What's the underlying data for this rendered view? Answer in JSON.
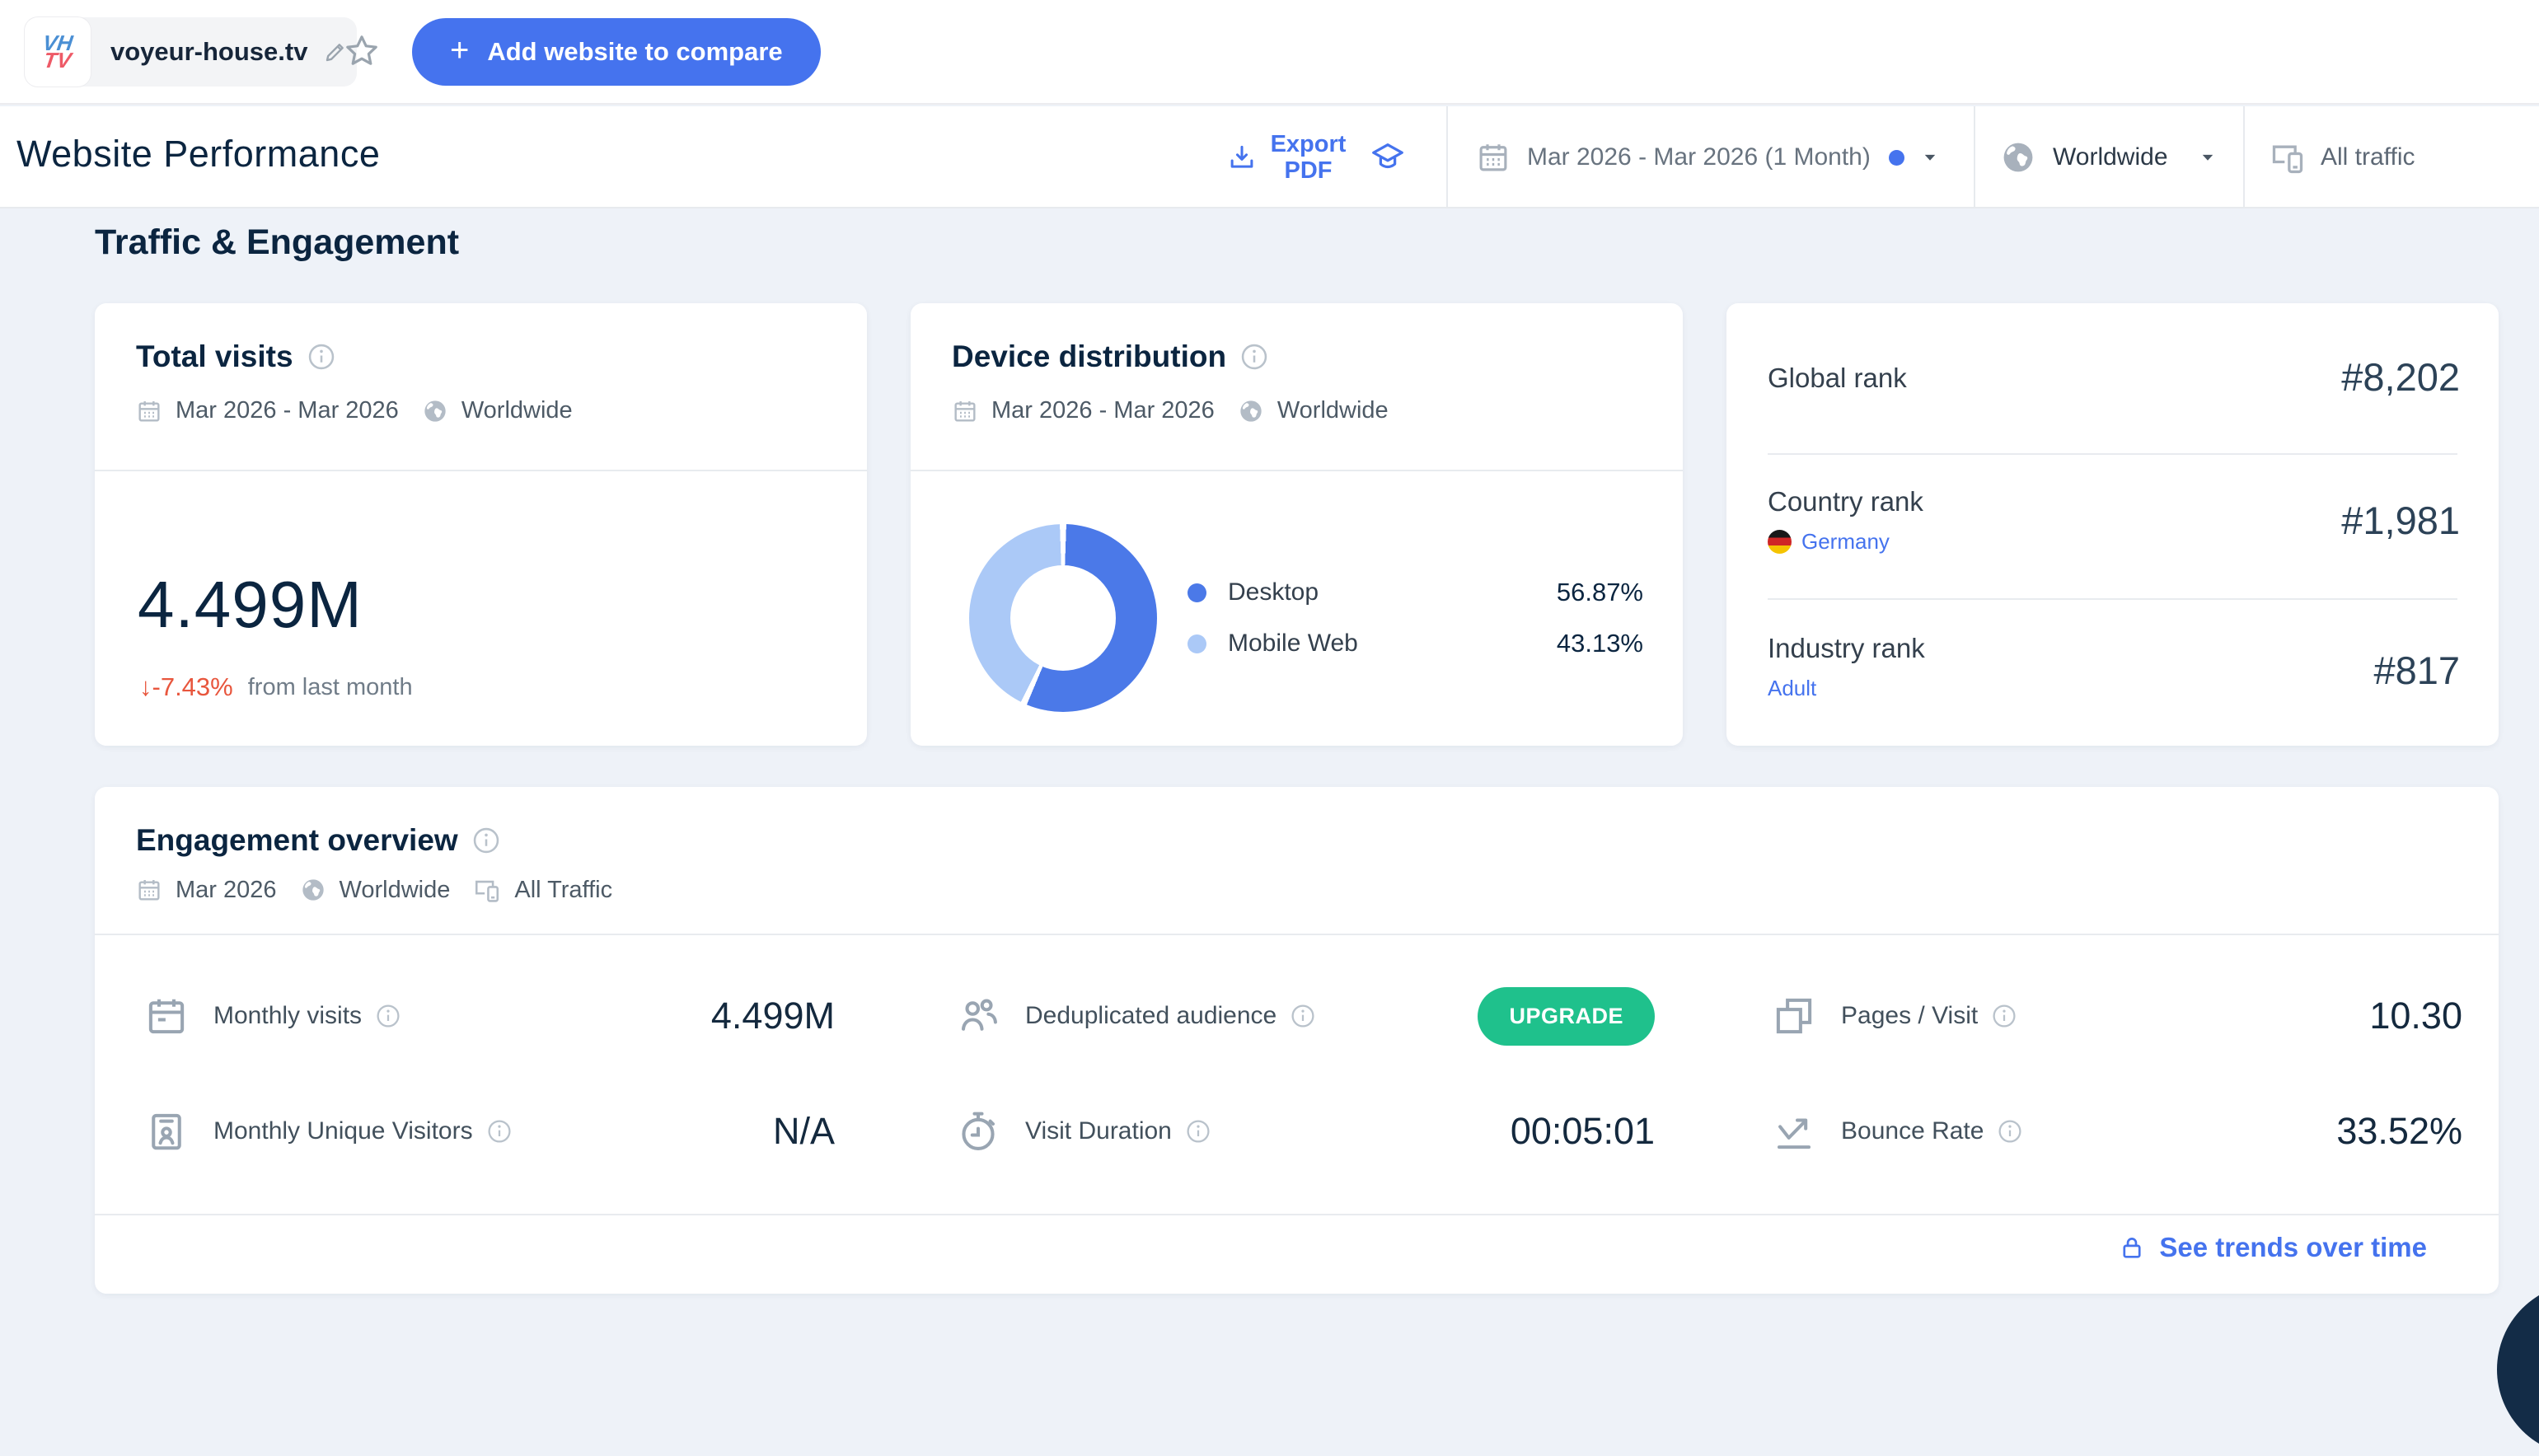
{
  "top_bar": {
    "favicon": {
      "line1": "VH",
      "line2": "TV"
    },
    "domain": "voyeur-house.tv",
    "compare": {
      "plus": "+",
      "label": "Add website to compare"
    }
  },
  "header": {
    "title": "Website Performance",
    "export_pdf": {
      "line1": "Export",
      "line2": "PDF"
    },
    "date_range": "Mar 2026 - Mar 2026 (1 Month)",
    "geo": "Worldwide",
    "traffic": "All traffic"
  },
  "section_title": "Traffic & Engagement",
  "total_visits": {
    "title": "Total visits",
    "date": "Mar 2026 - Mar 2026",
    "geo": "Worldwide",
    "value": "4.499M",
    "change": "↓-7.43%",
    "change_note": "from last month"
  },
  "device_distribution": {
    "title": "Device distribution",
    "date": "Mar 2026 - Mar 2026",
    "geo": "Worldwide"
  },
  "ranks": {
    "global_label": "Global rank",
    "global_value": "#8,202",
    "country_label": "Country rank",
    "country_link": "Germany",
    "country_value": "#1,981",
    "industry_label": "Industry rank",
    "industry_link": "Adult",
    "industry_value": "#817"
  },
  "engagement": {
    "title": "Engagement overview",
    "date": "Mar 2026",
    "geo": "Worldwide",
    "traffic": "All Traffic",
    "metrics": [
      {
        "label": "Monthly visits",
        "value": "4.499M"
      },
      {
        "label": "Deduplicated audience",
        "value": "UPGRADE"
      },
      {
        "label": "Pages / Visit",
        "value": "10.30"
      },
      {
        "label": "Monthly Unique Visitors",
        "value": "N/A"
      },
      {
        "label": "Visit Duration",
        "value": "00:05:01"
      },
      {
        "label": "Bounce Rate",
        "value": "33.52%"
      }
    ],
    "footer_link": "See trends over time"
  },
  "chart_data": {
    "type": "pie",
    "donut": true,
    "title": "Device distribution",
    "categories": [
      "Desktop",
      "Mobile Web"
    ],
    "values": [
      56.87,
      43.13
    ],
    "unit": "%",
    "colors": [
      "#4b79e8",
      "#abc9f7"
    ],
    "legend_position": "right",
    "legend": [
      {
        "label": "Desktop",
        "value": "56.87%"
      },
      {
        "label": "Mobile Web",
        "value": "43.13%"
      }
    ]
  },
  "colors": {
    "accent": "#4573ee",
    "green": "#1fc18c",
    "red": "#e8563d",
    "navy": "#0b2540",
    "fab": "#132c47"
  }
}
